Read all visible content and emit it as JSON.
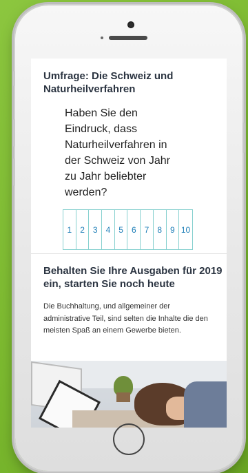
{
  "survey": {
    "title": "Umfrage: Die Schweiz und Naturheilverfahren",
    "question": "Haben Sie den Eindruck, dass Naturheilverfahren in der Schweiz von Jahr zu Jahr beliebter werden?",
    "options": [
      "1",
      "2",
      "3",
      "4",
      "5",
      "6",
      "7",
      "8",
      "9",
      "10"
    ]
  },
  "article": {
    "title": "Behalten Sie Ihre Ausgaben für 2019 ein, starten Sie noch heute",
    "body": "Die Buchhaltung, und allgemeiner der administrative Teil, sind selten die Inhalte die den meisten Spaß an einem Gewerbe bieten."
  },
  "colors": {
    "background": "#8cc63f",
    "rating_border": "#86d0cf",
    "rating_text": "#1d7eb7"
  }
}
